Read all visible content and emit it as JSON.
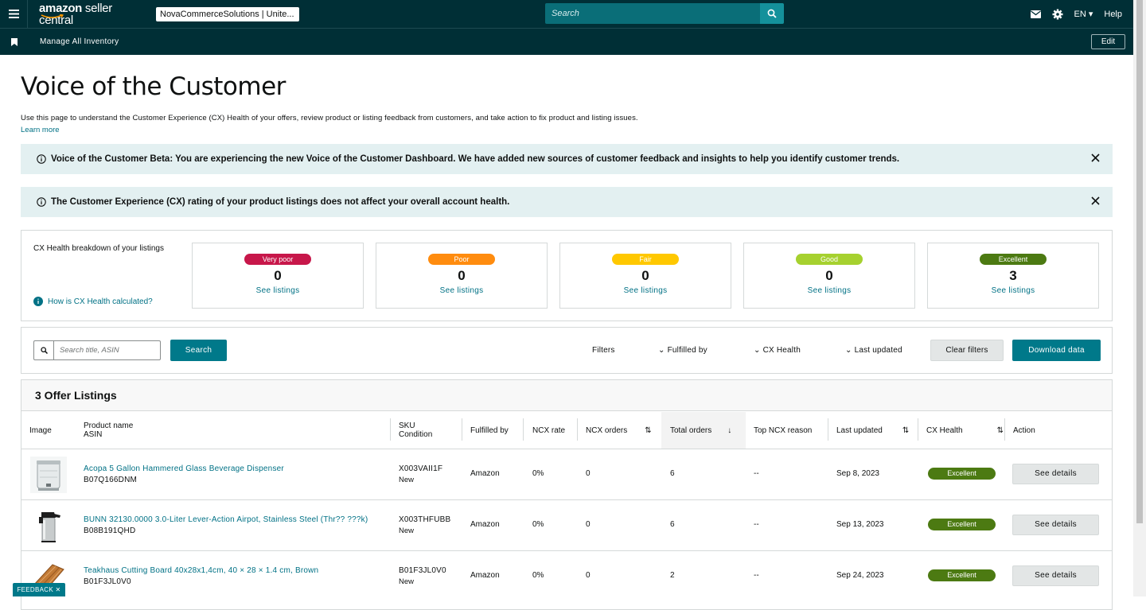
{
  "topbar": {
    "logo_main": "amazon",
    "logo_sub": " seller central",
    "account": "NovaCommerceSolutions | Unite...",
    "search_placeholder": "Search",
    "language": "EN",
    "help": "Help"
  },
  "subbar": {
    "bookmark": "Manage All Inventory",
    "edit": "Edit"
  },
  "page": {
    "title": "Voice of the Customer",
    "intro": "Use this page to understand the Customer Experience (CX) Health of your offers, review product or listing feedback from customers, and take action to fix product and listing issues.",
    "learn_more": "Learn more"
  },
  "banners": [
    "Voice of the Customer Beta: You are experiencing the new Voice of the Customer Dashboard. We have added new sources of customer feedback and insights to help you identify customer trends.",
    "The Customer Experience (CX) rating of your product listings does not affect your overall account health."
  ],
  "cx_breakdown": {
    "label": "CX Health breakdown of your listings",
    "how_link": "How is CX Health calculated?",
    "cards": [
      {
        "label": "Very poor",
        "count": "0",
        "link": "See listings",
        "color": "#c7174a"
      },
      {
        "label": "Poor",
        "count": "0",
        "link": "See listings",
        "color": "#ff8c0f"
      },
      {
        "label": "Fair",
        "count": "0",
        "link": "See listings",
        "color": "#ffc800"
      },
      {
        "label": "Good",
        "count": "0",
        "link": "See listings",
        "color": "#a6d12f"
      },
      {
        "label": "Excellent",
        "count": "3",
        "link": "See listings",
        "color": "#4c7a12"
      }
    ]
  },
  "filters": {
    "search_placeholder": "Search title, ASIN",
    "search_button": "Search",
    "filters_label": "Filters",
    "fulfilled_by": "Fulfilled by",
    "cx_health": "CX Health",
    "last_updated": "Last updated",
    "clear": "Clear filters",
    "download": "Download data"
  },
  "table": {
    "title": "3 Offer Listings",
    "headers": {
      "image": "Image",
      "product_name": "Product name",
      "asin": "ASIN",
      "sku": "SKU",
      "condition": "Condition",
      "fulfilled_by": "Fulfilled by",
      "ncx_rate": "NCX rate",
      "ncx_orders": "NCX orders",
      "total_orders": "Total orders",
      "top_reason": "Top NCX reason",
      "last_updated": "Last updated",
      "cx_health": "CX Health",
      "action": "Action"
    },
    "rows": [
      {
        "name": "Acopa 5 Gallon Hammered Glass Beverage Dispenser",
        "asin": "B07Q166DNM",
        "sku": "X003VAII1F",
        "condition": "New",
        "fulfilled": "Amazon",
        "ncx_rate": "0%",
        "ncx_orders": "0",
        "total": "6",
        "reason": "--",
        "updated": "Sep 8, 2023",
        "health": "Excellent",
        "action": "See details"
      },
      {
        "name": "BUNN 32130.0000 3.0-Liter Lever-Action Airpot, Stainless Steel (Thr?? ???k)",
        "asin": "B08B191QHD",
        "sku": "X003THFUBB",
        "condition": "New",
        "fulfilled": "Amazon",
        "ncx_rate": "0%",
        "ncx_orders": "0",
        "total": "6",
        "reason": "--",
        "updated": "Sep 13, 2023",
        "health": "Excellent",
        "action": "See details"
      },
      {
        "name": "Teakhaus Cutting Board 40x28x1,4cm, 40 × 28 × 1.4 cm, Brown",
        "asin": "B01F3JL0V0",
        "sku": "B01F3JL0V0",
        "condition": "New",
        "fulfilled": "Amazon",
        "ncx_rate": "0%",
        "ncx_orders": "0",
        "total": "2",
        "reason": "--",
        "updated": "Sep 24, 2023",
        "health": "Excellent",
        "action": "See details"
      }
    ]
  },
  "feedback": "FEEDBACK",
  "colors": {
    "nav": "#002f36",
    "accent": "#00798a",
    "banner": "#e3f0f1"
  }
}
